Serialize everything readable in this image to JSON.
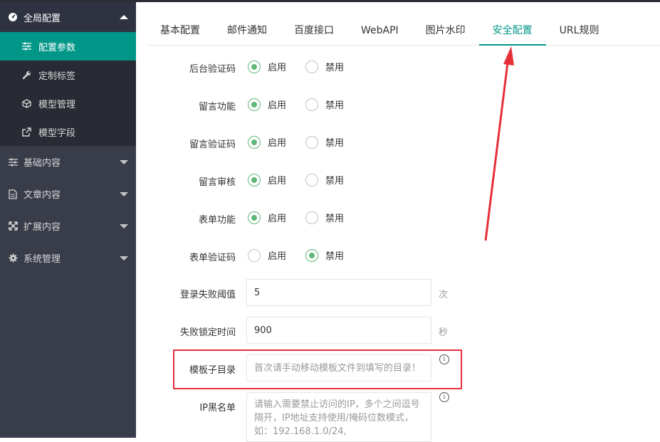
{
  "sidebar": {
    "group": {
      "label": "全局配置",
      "icon": "dashboard-icon"
    },
    "sub_items": [
      {
        "label": "配置参数",
        "icon": "sliders-icon",
        "active": true
      },
      {
        "label": "定制标签",
        "icon": "wrench-icon",
        "active": false
      },
      {
        "label": "模型管理",
        "icon": "cube-icon",
        "active": false
      },
      {
        "label": "模型字段",
        "icon": "external-link-icon",
        "active": false
      }
    ],
    "items": [
      {
        "label": "基础内容",
        "icon": "sliders-icon"
      },
      {
        "label": "文章内容",
        "icon": "file-icon"
      },
      {
        "label": "扩展内容",
        "icon": "expand-icon"
      },
      {
        "label": "系统管理",
        "icon": "gear-icon"
      }
    ]
  },
  "tabs": [
    {
      "label": "基本配置",
      "active": false
    },
    {
      "label": "邮件通知",
      "active": false
    },
    {
      "label": "百度接口",
      "active": false
    },
    {
      "label": "WebAPI",
      "active": false
    },
    {
      "label": "图片水印",
      "active": false
    },
    {
      "label": "安全配置",
      "active": true
    },
    {
      "label": "URL规则",
      "active": false
    }
  ],
  "radio_rows": [
    {
      "label": "后台验证码",
      "options": [
        "启用",
        "禁用"
      ],
      "selected": "启用"
    },
    {
      "label": "留言功能",
      "options": [
        "启用",
        "禁用"
      ],
      "selected": "启用"
    },
    {
      "label": "留言验证码",
      "options": [
        "启用",
        "禁用"
      ],
      "selected": "启用"
    },
    {
      "label": "留言审核",
      "options": [
        "启用",
        "禁用"
      ],
      "selected": "启用"
    },
    {
      "label": "表单功能",
      "options": [
        "启用",
        "禁用"
      ],
      "selected": "启用"
    },
    {
      "label": "表单验证码",
      "options": [
        "启用",
        "禁用"
      ],
      "selected": "禁用"
    }
  ],
  "login_fail": {
    "label": "登录失败阈值",
    "value": "5",
    "unit": "次"
  },
  "lock_time": {
    "label": "失败锁定时间",
    "value": "900",
    "unit": "秒"
  },
  "template_dir": {
    "label": "模板子目录",
    "placeholder": "首次请手动移动模板文件到填写的目录！",
    "info": "i"
  },
  "ip_blacklist": {
    "label": "IP黑名单",
    "placeholder": "请输入需要禁止访问的IP，多个之间逗号隔开，IP地址支持使用/掩码位数模式，如：192.168.1.0/24,",
    "info": "i"
  },
  "colors": {
    "accent": "#009688",
    "radio_on": "#5fb878",
    "sidebar": "#393d49",
    "annotation": "#e5303a"
  }
}
